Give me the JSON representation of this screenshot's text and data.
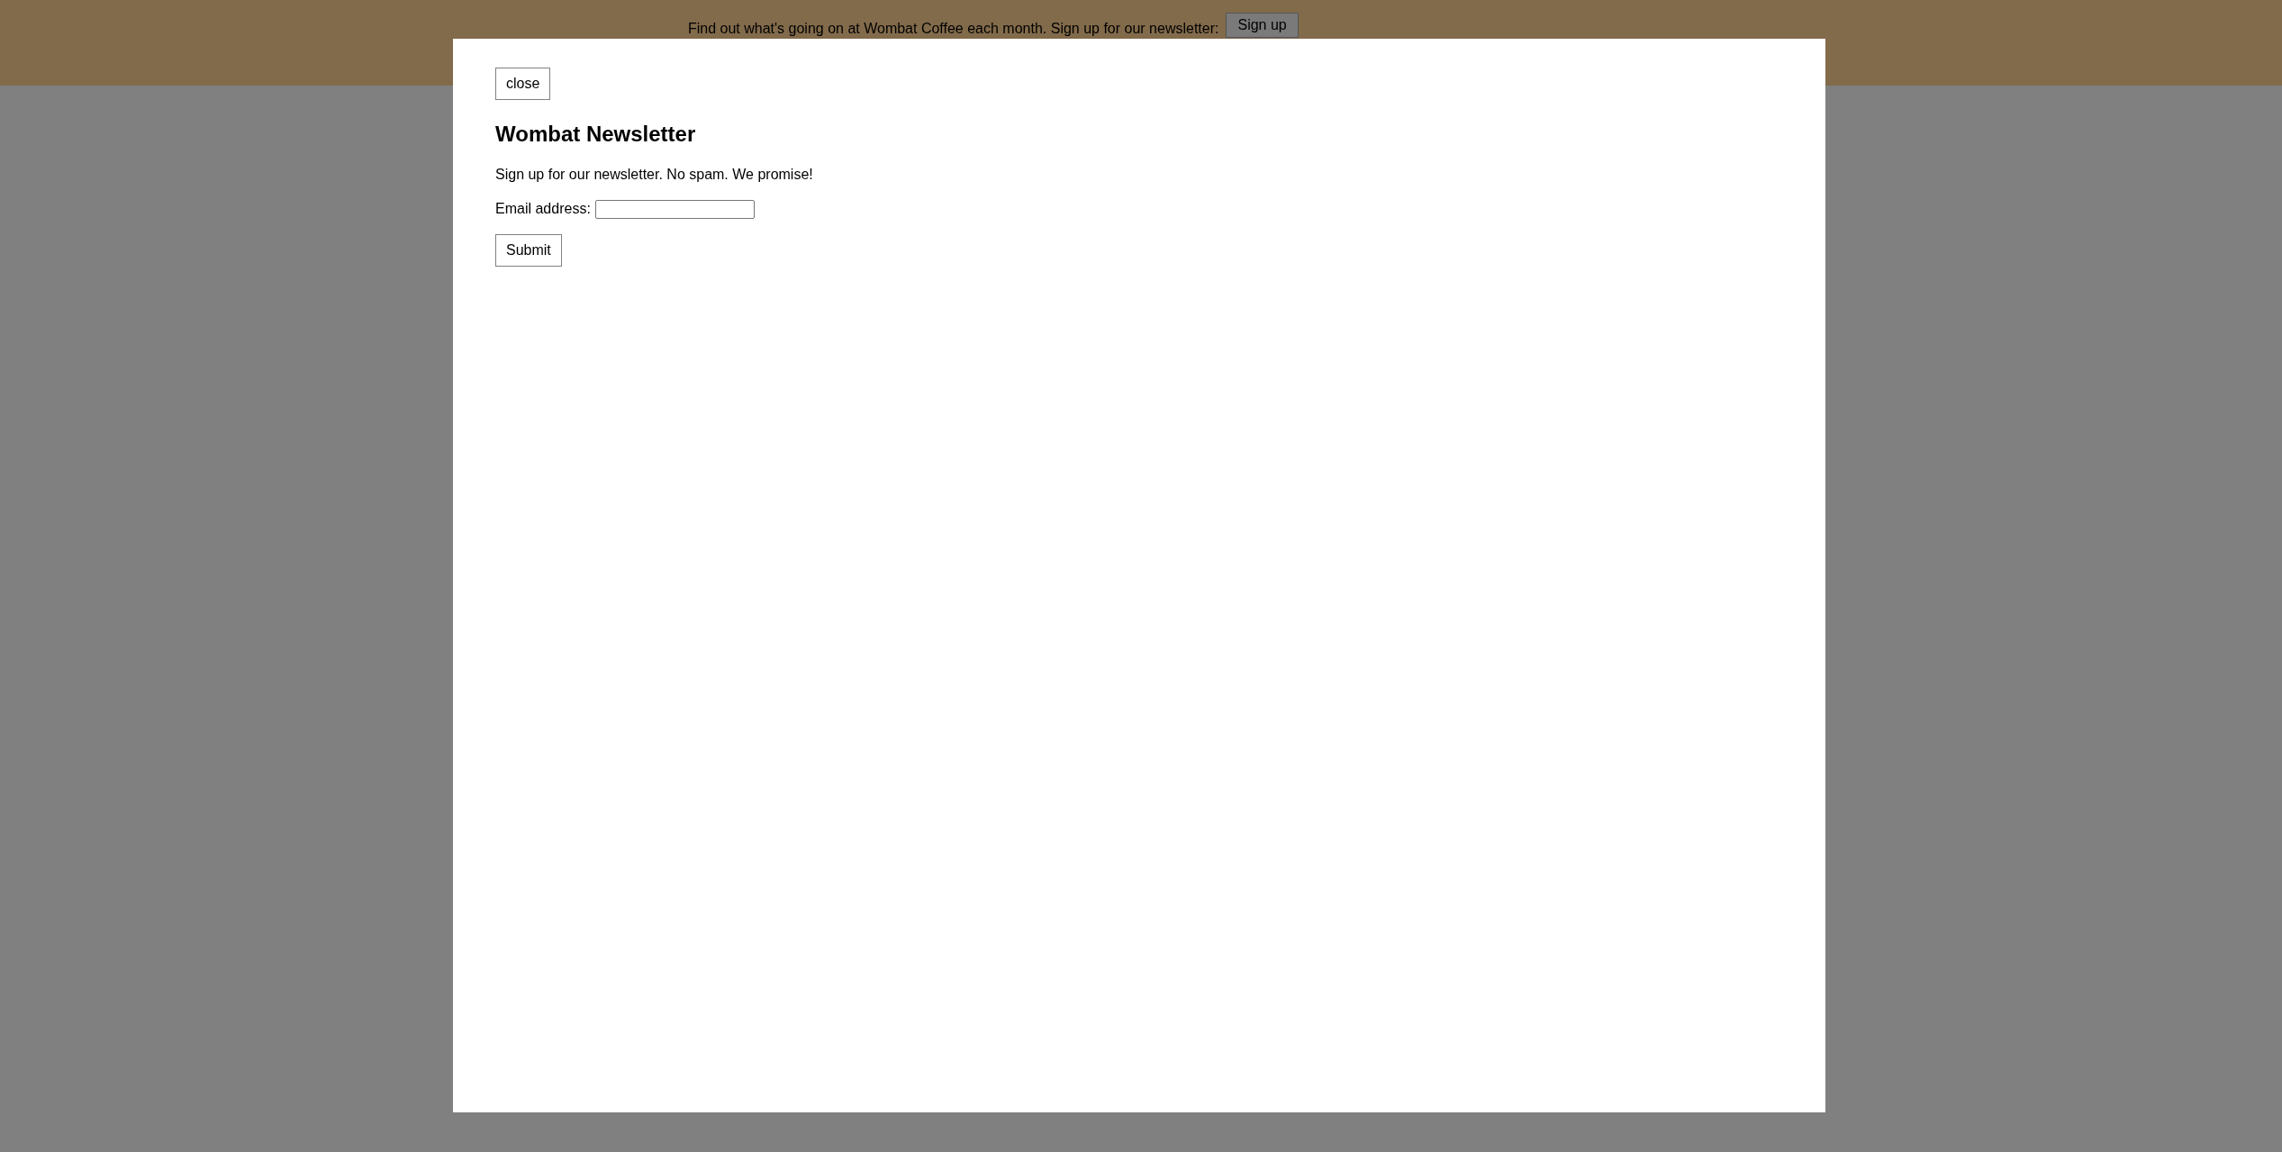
{
  "banner": {
    "text": "Find out what's going on at Wombat Coffee each month. Sign up for our newsletter:",
    "button": "Sign up"
  },
  "modal": {
    "close_button": "close",
    "title": "Wombat Newsletter",
    "text": "Sign up for our newsletter. No spam. We promise!",
    "email_label": "Email address:",
    "submit_button": "Submit"
  }
}
